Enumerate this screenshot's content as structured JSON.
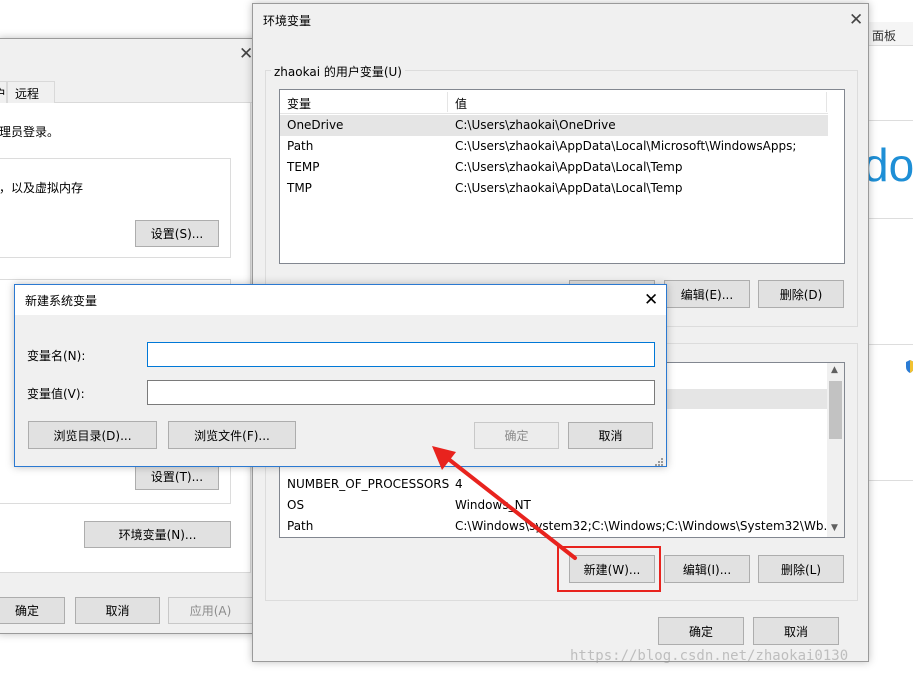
{
  "bg_window": {
    "panel_text": "面板",
    "big_text": "dow"
  },
  "sys_props": {
    "tabs": [
      "户",
      "远程"
    ],
    "admin_text": "理员登录。",
    "vm_text": "，以及虚拟内存",
    "settings_btn_1": "设置(S)...",
    "settings_btn_2": "设置(T)...",
    "env_btn": "环境变量(N)...",
    "ok": "确定",
    "cancel": "取消",
    "apply": "应用(A)"
  },
  "env_dialog": {
    "title": "环境变量",
    "user_group_label": "zhaokai 的用户变量(U)",
    "columns": [
      "变量",
      "值"
    ],
    "user_vars": [
      {
        "name": "OneDrive",
        "value": "C:\\Users\\zhaokai\\OneDrive"
      },
      {
        "name": "Path",
        "value": "C:\\Users\\zhaokai\\AppData\\Local\\Microsoft\\WindowsApps;"
      },
      {
        "name": "TEMP",
        "value": "C:\\Users\\zhaokai\\AppData\\Local\\Temp"
      },
      {
        "name": "TMP",
        "value": "C:\\Users\\zhaokai\\AppData\\Local\\Temp"
      }
    ],
    "user_edit": "编辑(E)...",
    "user_delete": "删除(D)",
    "sys_vars": [
      {
        "name": "NUMBER_OF_PROCESSORS",
        "value": "4"
      },
      {
        "name": "OS",
        "value": "Windows_NT"
      },
      {
        "name": "Path",
        "value": "C:\\Windows\\system32;C:\\Windows;C:\\Windows\\System32\\Wb..."
      }
    ],
    "sys_new": "新建(W)...",
    "sys_edit": "编辑(I)...",
    "sys_delete": "删除(L)",
    "ok": "确定",
    "cancel": "取消"
  },
  "new_var_dialog": {
    "title": "新建系统变量",
    "name_label": "变量名(N):",
    "value_label": "变量值(V):",
    "name_value": "",
    "value_value": "",
    "browse_dir": "浏览目录(D)...",
    "browse_file": "浏览文件(F)...",
    "ok": "确定",
    "cancel": "取消"
  },
  "watermark": "https://blog.csdn.net/zhaokai0130",
  "colors": {
    "annotation_red": "#e8231e",
    "focus_blue": "#0078d7"
  }
}
